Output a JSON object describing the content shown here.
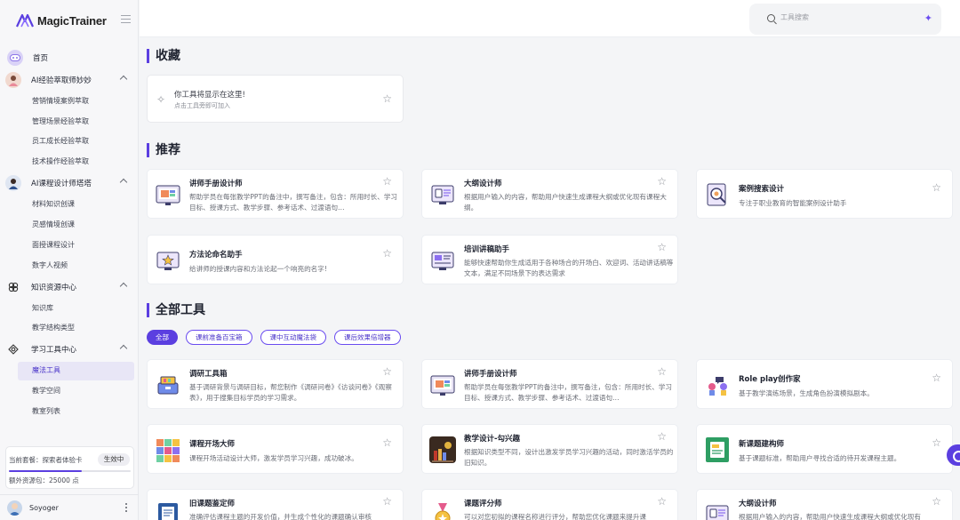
{
  "app": {
    "name": "MagicTrainer"
  },
  "sidebar": {
    "home_label": "首页",
    "groups": [
      {
        "label": "AI经验萃取师妙妙",
        "items": [
          "营销情境案例萃取",
          "管理场景经验萃取",
          "员工成长经验萃取",
          "技术操作经验萃取"
        ]
      },
      {
        "label": "AI课程设计师塔塔",
        "items": [
          "材料知识创课",
          "灵感情境创课",
          "面授课程设计",
          "数字人视频"
        ]
      },
      {
        "label": "知识资源中心",
        "items": [
          "知识库",
          "教学结构类型"
        ]
      },
      {
        "label": "学习工具中心",
        "items": [
          "魔法工具",
          "教学空间",
          "教室列表"
        ]
      }
    ],
    "active_item": "魔法工具",
    "plan": {
      "label": "当前套餐：探索者体验卡",
      "badge": "生效中",
      "extra": "额外资源包：25000 点",
      "progress": 0.6
    },
    "user": {
      "name": "Soyoger"
    }
  },
  "search": {
    "placeholder": "工具搜索"
  },
  "favorites": {
    "title": "收藏",
    "empty_title": "你工具将显示在这里!",
    "empty_hint": "点击工具旁即可加入"
  },
  "recommended": {
    "title": "推荐",
    "cards": [
      {
        "title": "讲师手册设计师",
        "desc": "帮助学员在每张教学PPT的备注中，撰写备注，包含：所用时长、学习目标、授课方式、教学步骤、参考话术、过渡语句…",
        "icon": "ppt-icon"
      },
      {
        "title": "大纲设计师",
        "desc": "根据用户输入的内容，帮助用户快速生成课程大纲或优化现有课程大纲。",
        "icon": "outline-icon"
      },
      {
        "title": "案例搜索设计",
        "desc": "专注于职业教育的智能案例设计助手",
        "icon": "case-search-icon"
      },
      {
        "title": "方法论命名助手",
        "desc": "给讲师的授课内容和方法论起一个响亮的名字!",
        "icon": "naming-icon"
      },
      {
        "title": "培训讲稿助手",
        "desc": "能够快速帮助你生成适用于各种场合的开场白、欢迎词、活动讲话稿等文本，满足不同场景下的表达需求",
        "icon": "script-icon"
      }
    ]
  },
  "all_tools": {
    "title": "全部工具",
    "filters": [
      "全部",
      "课前准备百宝箱",
      "课中互动魔法袋",
      "课后效果倍增器"
    ],
    "cards": [
      {
        "title": "调研工具箱",
        "desc": "基于调研背景与调研目标，帮您制作《调研问卷》《访谈问卷》《观察表》，用于搜集目标学员的学习需求。",
        "icon": "toolbox-icon"
      },
      {
        "title": "讲师手册设计师",
        "desc": "帮助学员在每张教学PPT的备注中，撰写备注，包含：所用时长、学习目标、授课方式、教学步骤、参考话术、过渡语句…",
        "icon": "ppt-icon"
      },
      {
        "title": "Role play创作家",
        "desc": "基于教学演练场景，生成角色扮演模拟剧本。",
        "icon": "roleplay-icon"
      },
      {
        "title": "课程开场大师",
        "desc": "课程开场活动设计大师，激发学员学习兴趣，成功破冰。",
        "icon": "cubes-icon"
      },
      {
        "title": "教学设计-勾兴趣",
        "desc": "根据知识类型不同，设计出激发学员学习兴趣的活动，同时激活学员的旧知识。",
        "icon": "books-icon"
      },
      {
        "title": "新课题建构师",
        "desc": "基于课题标准，帮助用户寻找合适的待开发课程主题。",
        "icon": "document-icon"
      },
      {
        "title": "旧课题鉴定师",
        "desc": "准确评估课程主题的开发价值，并生成个性化的课题确认审核",
        "icon": "report-icon"
      },
      {
        "title": "课题评分师",
        "desc": "可以对您初拟的课程名称进行评分，帮助您优化课题来提升课",
        "icon": "medal-icon"
      },
      {
        "title": "大纲设计师",
        "desc": "根据用户输入的内容，帮助用户快速生成课程大纲或优化现有",
        "icon": "outline-icon"
      }
    ]
  },
  "colors": {
    "accent": "#5b3fe0"
  }
}
